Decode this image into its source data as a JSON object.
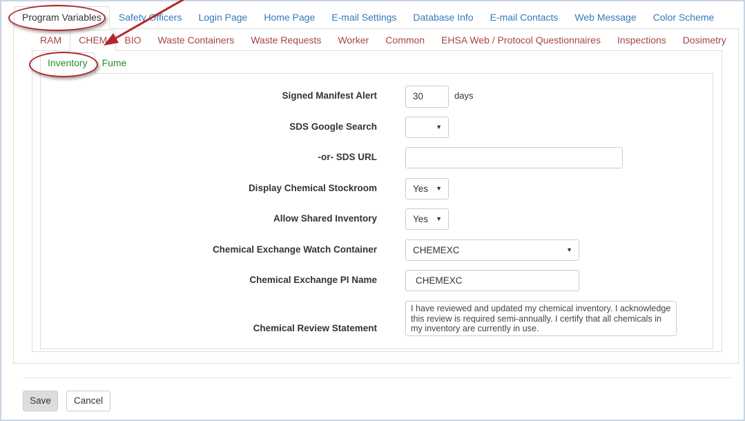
{
  "tabs_top": [
    "Program Variables",
    "Safety Officers",
    "Login Page",
    "Home Page",
    "E-mail Settings",
    "Database Info",
    "E-mail Contacts",
    "Web Message",
    "Color Scheme"
  ],
  "tabs_program": [
    "RAM",
    "CHEM",
    "BIO",
    "Waste Containers",
    "Waste Requests",
    "Worker",
    "Common",
    "EHSA Web / Protocol Questionnaires",
    "Inspections",
    "Dosimetry"
  ],
  "tabs_chem": [
    "Inventory",
    "Fume"
  ],
  "form": {
    "signed_manifest_alert": {
      "label": "Signed Manifest Alert",
      "value": "30",
      "unit": "days"
    },
    "sds_google_search": {
      "label": "SDS Google Search",
      "value": ""
    },
    "sds_url": {
      "label": "-or- SDS URL",
      "value": ""
    },
    "display_chemical_stockroom": {
      "label": "Display Chemical Stockroom",
      "value": "Yes"
    },
    "allow_shared_inventory": {
      "label": "Allow Shared Inventory",
      "value": "Yes"
    },
    "chemical_exchange_watch_container": {
      "label": "Chemical Exchange Watch Container",
      "value": "CHEMEXC"
    },
    "chemical_exchange_pi_name": {
      "label": "Chemical Exchange PI Name",
      "value": "CHEMEXC"
    },
    "chemical_review_statement": {
      "label": "Chemical Review Statement",
      "value": "I have reviewed and updated my chemical inventory. I acknowledge this review is required semi-annually. I certify that all chemicals in my inventory are currently in use."
    }
  },
  "buttons": {
    "save": "Save",
    "cancel": "Cancel"
  },
  "icons": {
    "dropdown": "chevron-down-icon"
  },
  "colors": {
    "link_blue": "#337ab7",
    "chem_tab_red": "#a94442",
    "inventory_tab_green": "#2a8a2a",
    "annotation_red": "#b3262b"
  }
}
